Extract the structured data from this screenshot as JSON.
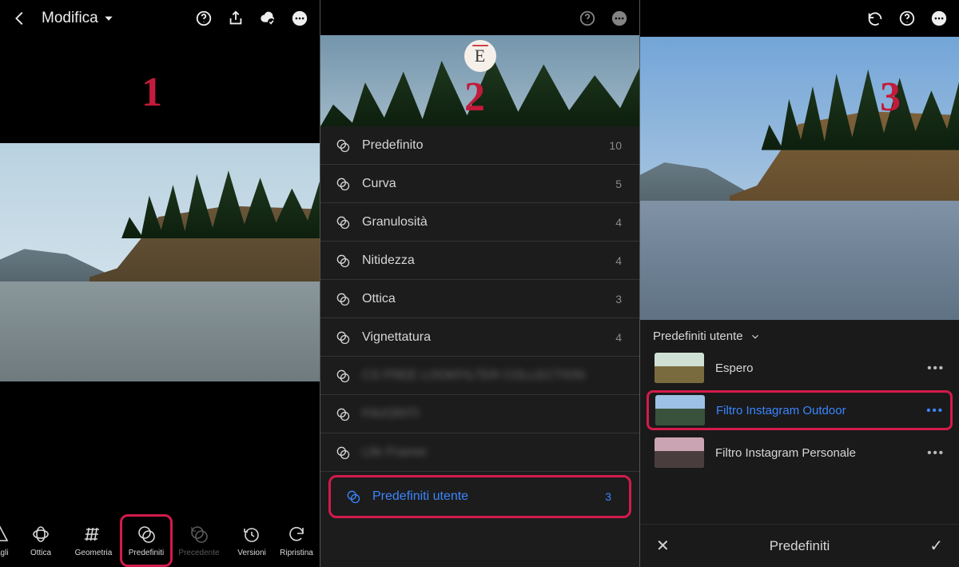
{
  "step_labels": {
    "one": "1",
    "two": "2",
    "three": "3"
  },
  "panel1": {
    "title": "Modifica",
    "tools": {
      "dettagli": "ttagli",
      "ottica": "Ottica",
      "geometria": "Geometria",
      "predefiniti": "Predefiniti",
      "precedente": "Precedente",
      "versioni": "Versioni",
      "ripristina": "Ripristina"
    }
  },
  "panel2": {
    "badge_letter": "E",
    "rows": [
      {
        "label": "Predefinito",
        "count": "10"
      },
      {
        "label": "Curva",
        "count": "5"
      },
      {
        "label": "Granulosità",
        "count": "4"
      },
      {
        "label": "Nitidezza",
        "count": "4"
      },
      {
        "label": "Ottica",
        "count": "3"
      },
      {
        "label": "Vignettatura",
        "count": "4"
      },
      {
        "label": "CS  FREE LOOKFILTER COLLECTION",
        "count": ""
      },
      {
        "label": "FAVORITI",
        "count": ""
      },
      {
        "label": "Life Framer",
        "count": ""
      },
      {
        "label": "Predefiniti utente",
        "count": "3"
      }
    ]
  },
  "panel3": {
    "group_title": "Predefiniti utente",
    "items": [
      {
        "name": "Espero"
      },
      {
        "name": "Filtro Instagram Outdoor"
      },
      {
        "name": "Filtro Instagram Personale"
      }
    ],
    "footer_title": "Predefiniti"
  }
}
